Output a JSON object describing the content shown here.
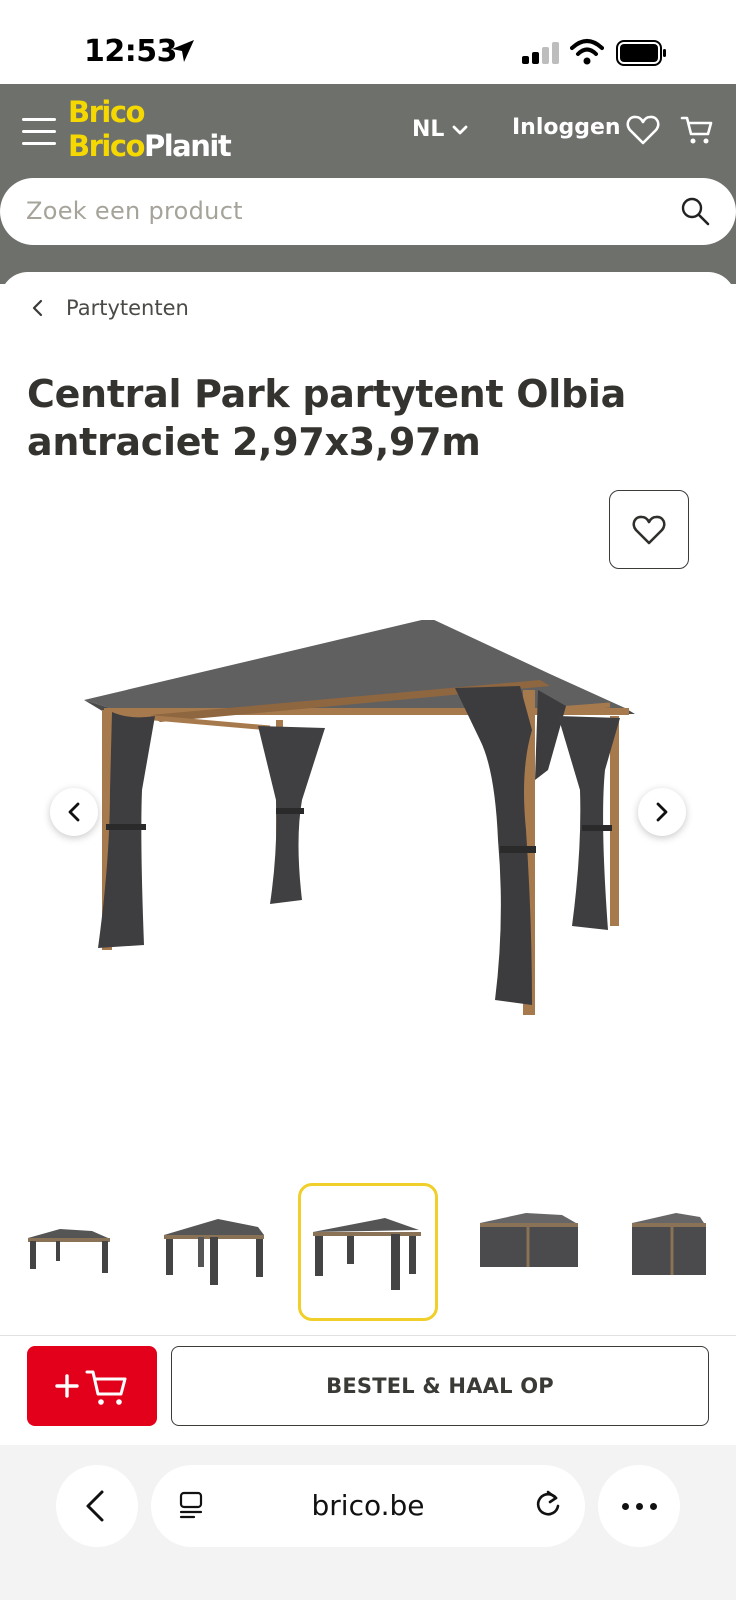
{
  "status_bar": {
    "time": "12:53"
  },
  "header": {
    "logo_line1": "Brico",
    "logo_line2_a": "Brico",
    "logo_line2_b": "Planit",
    "language": "NL",
    "login_label": "Inloggen",
    "icons": [
      "menu-icon",
      "heart-icon",
      "cart-icon"
    ],
    "background_color": "#6e706c",
    "brand_yellow": "#f5d800"
  },
  "search": {
    "placeholder": "Zoek een product"
  },
  "breadcrumb": {
    "back_label": "Partytenten"
  },
  "product": {
    "title": "Central Park partytent Olbia antraciet 2,97x3,97m",
    "image_alt": "Partytent met antraciet dak en gordijnen",
    "thumbnails": [
      {
        "label": "thumbnail-1",
        "active": false
      },
      {
        "label": "thumbnail-2",
        "active": false
      },
      {
        "label": "thumbnail-3",
        "active": true
      },
      {
        "label": "thumbnail-4",
        "active": false
      },
      {
        "label": "thumbnail-5",
        "active": false
      }
    ]
  },
  "actions": {
    "add_to_cart_symbol": "+",
    "order_label": "BESTEL & HAAL OP",
    "accent_red": "#e2001a",
    "active_thumb_color": "#f0cf2a"
  },
  "browser": {
    "url": "brico.be"
  }
}
